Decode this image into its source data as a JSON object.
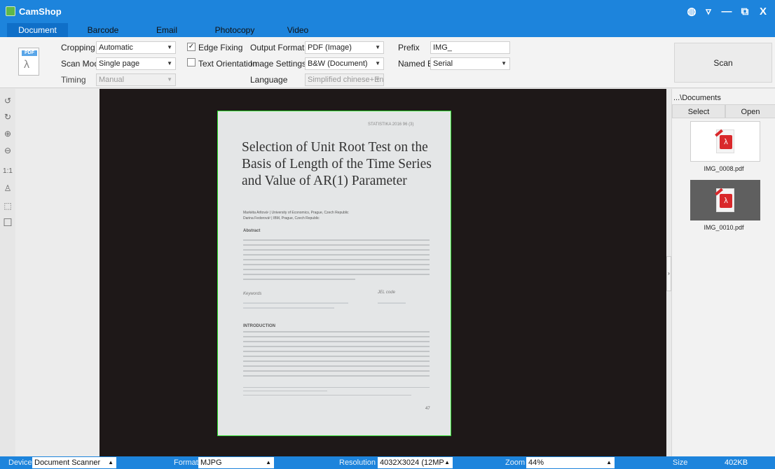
{
  "app": {
    "title": "CamShop"
  },
  "window_controls": {
    "globe": "◍",
    "menu": "▿",
    "minimize": "—",
    "restore": "⧉",
    "close": "X"
  },
  "tabs": [
    "Document",
    "Barcode",
    "Email",
    "Photocopy",
    "Video"
  ],
  "toolbar": {
    "file_icon_tag": "PDF",
    "cropping_label": "Cropping",
    "cropping_value": "Automatic",
    "scan_mode_label": "Scan Mode",
    "scan_mode_value": "Single page",
    "timing_label": "Timing",
    "timing_value": "Manual",
    "edge_fixing_label": "Edge Fixing",
    "edge_fixing_checked": "✓",
    "text_orientation_label": "Text Orientation",
    "output_format_label": "Output Format",
    "output_format_value": "PDF (Image)",
    "image_settings_label": "Image Settings",
    "image_settings_value": "B&W (Document)",
    "language_label": "Language",
    "language_value": "Simplified chinese+Eng",
    "prefix_label": "Prefix",
    "prefix_value": "IMG_",
    "named_by_label": "Named By",
    "named_by_value": "Serial",
    "scan_label": "Scan"
  },
  "side_tools": {
    "rotate_left": "↺",
    "rotate_right": "↻",
    "zoom_in": "⊕",
    "zoom_out": "⊖",
    "actual_size": "1:1",
    "stamp": "♙",
    "fit": "⬚",
    "crop": "☐"
  },
  "document": {
    "header": "STATISTIKA  2016  96 (3)",
    "title": "Selection of Unit Root Test on the Basis of Length of the Time Series and Value of AR(1) Parameter",
    "authors_line1": "Markéta Arltová¹ | University of Economics, Prague, Czech Republic",
    "authors_line2": "Darina Fedorová² | IBM, Prague, Czech Republic",
    "abstract_heading": "Abstract",
    "keywords_heading": "Keywords",
    "jel_heading": "JEL code",
    "intro_heading": "INTRODUCTION",
    "page_number": "47"
  },
  "right_panel": {
    "path": "...\\Documents",
    "select_label": "Select",
    "open_label": "Open",
    "files": [
      {
        "name": "IMG_0008.pdf",
        "selected": false
      },
      {
        "name": "IMG_0010.pdf",
        "selected": true
      }
    ]
  },
  "collapse_arrow": "›",
  "dropdown_arrow": "▼",
  "up_arrow": "▲",
  "status": {
    "device_label": "Device",
    "device_value": "Document Scanner",
    "format_label": "Format",
    "format_value": "MJPG",
    "resolution_label": "Resolution",
    "resolution_value": "4032X3024 (12MP",
    "zoom_label": "Zoom",
    "zoom_value": "44%",
    "size_label": "Size",
    "size_value": "402KB"
  },
  "colors": {
    "titlebar": "#1d84dc",
    "active_tab": "#0f6fc8",
    "crop_border": "#2adb2a",
    "pdf_red": "#d9282b"
  }
}
